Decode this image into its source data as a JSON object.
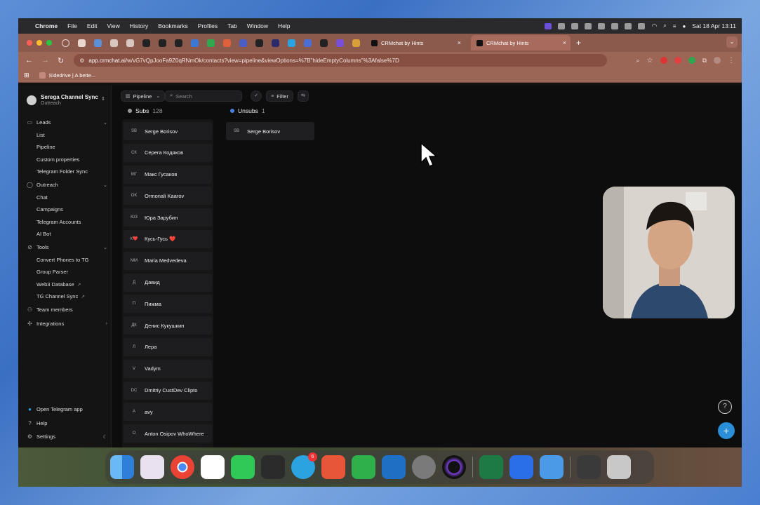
{
  "menubar": {
    "app": "Chrome",
    "items": [
      "File",
      "Edit",
      "View",
      "History",
      "Bookmarks",
      "Profiles",
      "Tab",
      "Window",
      "Help"
    ],
    "clock": "Sat 18 Apr  13:11"
  },
  "tabs": [
    {
      "title": "CRMchat by Hints",
      "active": false
    },
    {
      "title": "CRMchat by Hints",
      "active": true
    }
  ],
  "address": {
    "host": "app.crmchat.ai",
    "path": "/w/vG7vQpJooFa9Z0qRNmOk/contacts?view=pipeline&viewOptions=%7B\"hideEmptyColumns\"%3Afalse%7D"
  },
  "bookmarks": [
    "Sidedrive | A bette..."
  ],
  "workspace": {
    "name": "Serega Channel Sync",
    "sub": "Outreach"
  },
  "sidebar": {
    "leads": {
      "label": "Leads",
      "items": [
        "List",
        "Pipeline",
        "Custom properties",
        "Telegram Folder Sync"
      ]
    },
    "outreach": {
      "label": "Outreach",
      "items": [
        "Chat",
        "Campaigns",
        "Telegram Accounts",
        "AI Bot"
      ]
    },
    "tools": {
      "label": "Tools",
      "items": [
        "Convert Phones to TG",
        "Group Parser",
        "Web3 Database",
        "TG Channel Sync"
      ]
    },
    "team": "Team members",
    "integrations": "Integrations",
    "bottom": [
      "Open Telegram app",
      "Help",
      "Settings"
    ]
  },
  "toolbar": {
    "view": "Pipeline",
    "search_placeholder": "Search",
    "filter": "Filter"
  },
  "columns": [
    {
      "name": "Subs",
      "count": "128",
      "color": "#9a9a9a",
      "cards": [
        {
          "initials": "SB",
          "name": "Serge Borisov"
        },
        {
          "initials": "СК",
          "name": "Серега Кодяков"
        },
        {
          "initials": "МГ",
          "name": "Макс Гусаков"
        },
        {
          "initials": "OK",
          "name": "Ormonali Kaarov"
        },
        {
          "initials": "ЮЗ",
          "name": "Юра Зарубин"
        },
        {
          "initials": "К❤️",
          "name": "Кусь-Гусь ❤️"
        },
        {
          "initials": "MM",
          "name": "Maria Medvedeva"
        },
        {
          "initials": "Д",
          "name": "Давид"
        },
        {
          "initials": "П",
          "name": "Пижма"
        },
        {
          "initials": "ДК",
          "name": "Денис Кукушкин"
        },
        {
          "initials": "Л",
          "name": "Лера"
        },
        {
          "initials": "V",
          "name": "Vadym"
        },
        {
          "initials": "DC",
          "name": "Dmitriy CustDev Clipto"
        },
        {
          "initials": "A",
          "name": "avy"
        },
        {
          "initials": "O",
          "name": "Anton Osipov WhoWhere"
        }
      ]
    },
    {
      "name": "Unsubs",
      "count": "1",
      "color": "#4a7fe0",
      "cards": [
        {
          "initials": "SB",
          "name": "Serge Borisov"
        }
      ]
    }
  ],
  "dock": {
    "telegram_badge": "6"
  }
}
